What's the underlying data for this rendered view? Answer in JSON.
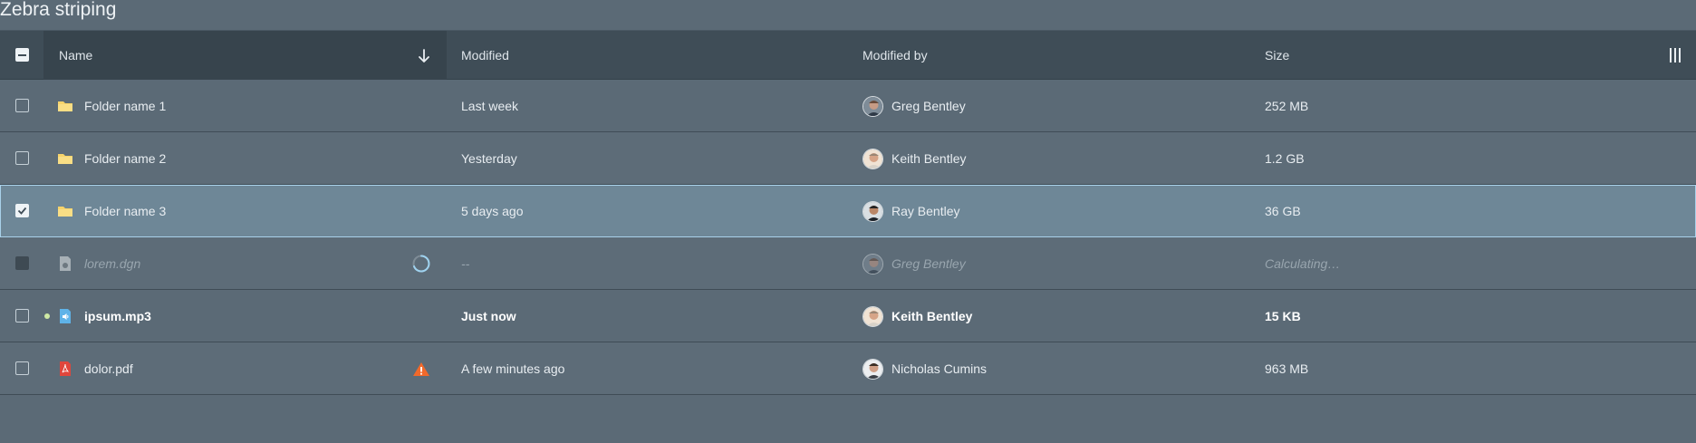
{
  "title": "Zebra striping",
  "columns": {
    "name": "Name",
    "modified": "Modified",
    "modified_by": "Modified by",
    "size": "Size"
  },
  "rows": [
    {
      "name": "Folder name 1",
      "modified": "Last week",
      "modified_by": "Greg Bentley",
      "size": "252 MB",
      "icon": "folder-icon",
      "state": "normal"
    },
    {
      "name": "Folder name 2",
      "modified": "Yesterday",
      "modified_by": "Keith Bentley",
      "size": "1.2 GB",
      "icon": "folder-icon",
      "state": "normal"
    },
    {
      "name": "Folder name 3",
      "modified": "5 days ago",
      "modified_by": "Ray Bentley",
      "size": "36 GB",
      "icon": "folder-icon",
      "state": "selected"
    },
    {
      "name": "lorem.dgn",
      "modified": "--",
      "modified_by": "Greg Bentley",
      "size": "Calculating…",
      "icon": "dgn-file-icon",
      "state": "pending",
      "status_icon": "loading-spinner-icon"
    },
    {
      "name": "ipsum.mp3",
      "modified": "Just now",
      "modified_by": "Keith Bentley",
      "size": "15 KB",
      "icon": "audio-file-icon",
      "state": "unread",
      "status_icon": "new-dot-icon"
    },
    {
      "name": "dolor.pdf",
      "modified": "A few minutes ago",
      "modified_by": "Nicholas Cumins",
      "size": "963 MB",
      "icon": "pdf-file-icon",
      "state": "normal",
      "status_icon": "warning-icon"
    }
  ],
  "colors": {
    "background": "#5b6a76",
    "header": "#3f4d57",
    "selected_row": "#6e8797",
    "selected_outline": "#a9d1ea",
    "folder": "#f6d36b",
    "warning": "#f1692b",
    "spinner": "#9fd3f0"
  }
}
